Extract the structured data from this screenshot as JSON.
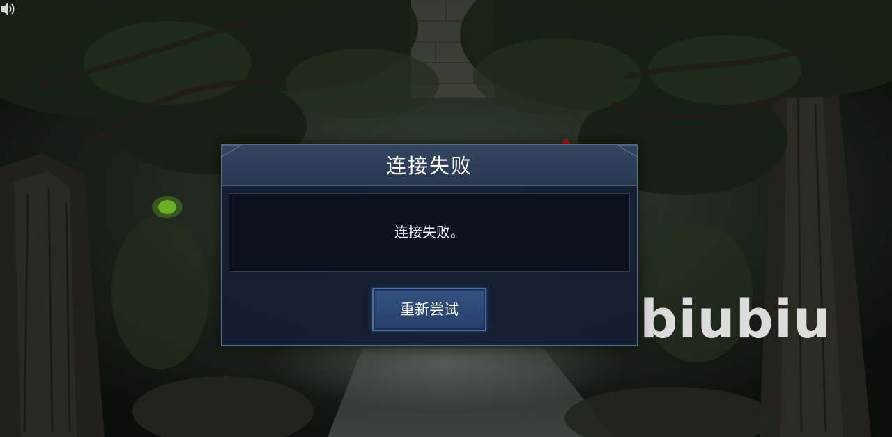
{
  "dialog": {
    "title": "连接失败",
    "message": "连接失败。",
    "retry_label": "重新尝试"
  },
  "watermark": {
    "text": "biubiu"
  },
  "icons": {
    "sound": "speaker-sound-icon"
  },
  "colors": {
    "dialog_bg": "#141e34",
    "header_bg": "#34445f",
    "button_bg": "#2f4a78",
    "button_border": "#4e6fa6",
    "text": "#ffffff"
  }
}
